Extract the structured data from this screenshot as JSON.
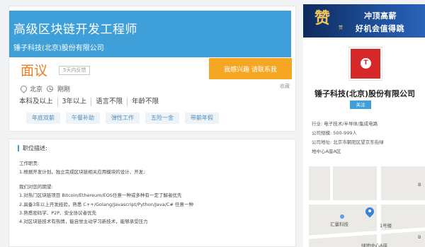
{
  "job": {
    "title": "高级区块链开发工程师",
    "company": "锤子科技(北京)股份有限公司",
    "salary": "面议",
    "feedback": "5天内反馈",
    "apply_label": "我感兴趣 请联系我",
    "collect_label": "收藏",
    "location": "北京",
    "posted": "刚刚",
    "requirements": [
      "本科及以上",
      "3年以上",
      "语言不限",
      "年龄不限"
    ],
    "benefits": [
      "年底双薪",
      "午餐补助",
      "弹性工作",
      "五险一金",
      "带薪年假"
    ]
  },
  "description": {
    "title": "职位描述:",
    "lines": [
      "工作职责:",
      "1.根据开发计划，独立完成区块链相关应用模块的设计、开发;",
      "",
      "我们对您的期望:",
      "1.对热门区块链项目 Bitcoin/Ethereum/EOS任意一种或多种有一定了解者优先",
      "2.具备3年以上开发经验，熟悉 C++/Golang/Javascript/Python/Java/C# 任意一种",
      "3.熟悉密码学、P2P、安全协议者优先",
      "4.对区块链技术有热情，能自觉主动学习新技术，能够承受压力"
    ]
  },
  "sidebar": {
    "banner": {
      "logo": "赞",
      "tag": "赞",
      "line1": "冲顶高薪",
      "line2": "好机会值得跳"
    },
    "logo_mark": "T",
    "company_name": "锤子科技(北京)股份有限公司",
    "follow_label": "关注",
    "info": [
      "行业: 电子技术/半导体/集成电路",
      "公司规模: 500-999人",
      "公司地址: 北京市朝阳区望京东街绿",
      "地中心A座A区"
    ],
    "map_labels": {
      "poi": "汇量科技",
      "road": "1号楼",
      "bottom": "绿地中心A座",
      "edge_top": "B",
      "edge_bottom": "B"
    }
  }
}
